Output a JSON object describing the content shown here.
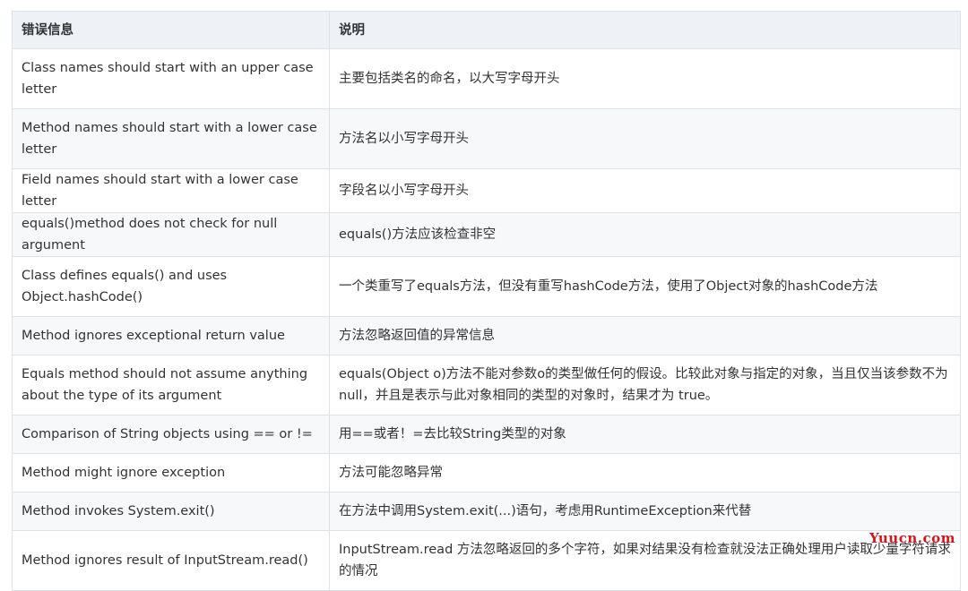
{
  "table": {
    "headers": [
      "错误信息",
      "说明"
    ],
    "rows": [
      [
        "Class names should start with an upper case letter",
        "主要包括类名的命名，以大写字母开头"
      ],
      [
        "Method names should start with a lower case letter",
        "方法名以小写字母开头"
      ],
      [
        "Field names should start with a lower case letter",
        "字段名以小写字母开头"
      ],
      [
        "equals()method does not check for null argument",
        "equals()方法应该检查非空"
      ],
      [
        "Class defines equals() and uses Object.hashCode()",
        "一个类重写了equals方法，但没有重写hashCode方法，使用了Object对象的hashCode方法"
      ],
      [
        "Method ignores exceptional return value",
        "方法忽略返回值的异常信息"
      ],
      [
        "Equals method should not assume anything about the type of its argument",
        "equals(Object o)方法不能对参数o的类型做任何的假设。比较此对象与指定的对象，当且仅当该参数不为 null，并且是表示与此对象相同的类型的对象时，结果才为 true。"
      ],
      [
        "Comparison of String objects using == or !=",
        "用==或者！=去比较String类型的对象"
      ],
      [
        "Method might ignore exception",
        "方法可能忽略异常"
      ],
      [
        "Method invokes System.exit()",
        "在方法中调用System.exit(...)语句，考虑用RuntimeException来代替"
      ],
      [
        "Method ignores result of InputStream.read()",
        "InputStream.read 方法忽略返回的多个字符，如果对结果没有检查就没法正确处理用户读取少量字符请求的情况"
      ]
    ]
  },
  "watermark": "Yuucn.com"
}
